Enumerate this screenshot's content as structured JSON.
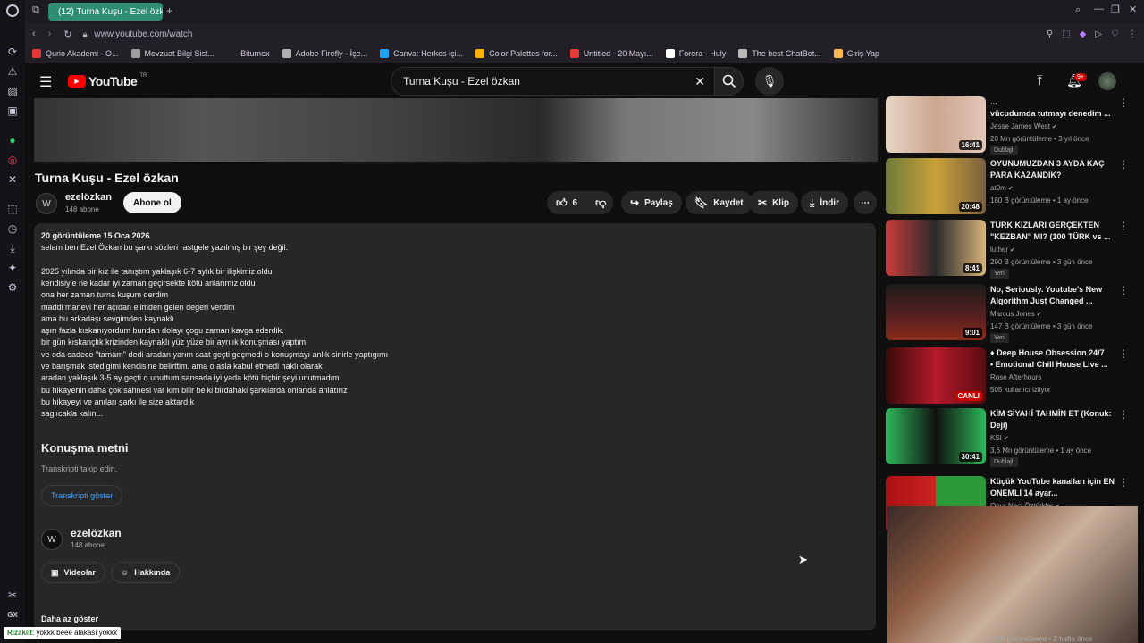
{
  "browser": {
    "tab_title": "(12) Turna Kuşu - Ezel özk",
    "url": "www.youtube.com/watch",
    "bookmarks": [
      {
        "label": "Qurio Akademi - O...",
        "color": "#e53935"
      },
      {
        "label": "Mevzuat Bilgi Sist...",
        "color": "#9e9e9e"
      },
      {
        "label": "Bitumex",
        "color": "#221f27"
      },
      {
        "label": "Adobe Firefly - İçe...",
        "color": "#b0b0b0"
      },
      {
        "label": "Canva: Herkes içi...",
        "color": "#20a4f3"
      },
      {
        "label": "Color Palettes for...",
        "color": "#ffb300"
      },
      {
        "label": "Untitled - 20 Mayı...",
        "color": "#e53935"
      },
      {
        "label": "Forera - Huly",
        "color": "#ffffff"
      },
      {
        "label": "The best ChatBot...",
        "color": "#bbbbbb"
      },
      {
        "label": "Giriş Yap",
        "color": "#ffb74d"
      }
    ]
  },
  "header": {
    "logo": "YouTube",
    "logo_sup": "TR",
    "search_value": "Turna Kuşu - Ezel özkan",
    "notif_count": "9+"
  },
  "video": {
    "title": "Turna Kuşu - Ezel özkan",
    "channel": "ezelözkan",
    "subs": "148 abone",
    "subscribe": "Abone ol",
    "likes": "6",
    "share": "Paylaş",
    "save": "Kaydet",
    "clip": "Klip",
    "download": "İndir"
  },
  "description": {
    "stats": "20 görüntüleme  15 Oca 2026",
    "lines": [
      "selam ben Ezel Özkan bu şarkı sözleri rastgele yazılmış bir şey değil.",
      "",
      "2025 yılında bir kız ile tanıştım yaklaşık 6-7 aylık bir ilişkimiz oldu",
      "kendisiyle ne kadar iyi zaman geçirsekte kötü anlarımız oldu",
      "ona her zaman turna kuşum derdim",
      "maddi manevi her açıdan elimden gelen degeri verdim",
      "ama bu arkadaşı sevgimden kaynaklı",
      "aşırı fazla kıskanıyordum bundan dolayı çogu zaman kavga ederdik.",
      "bir gün kıskançlık krizinden kaynaklı yüz yüze bir ayrılık konuşması yaptım",
      "ve oda sadece \"tamam\" dedi aradan yarım saat geçti geçmedi o konuşmayı anlık sinirle yaptıgımı",
      "ve barışmak istedigimi kendisine belirttim. ama o asla kabul etmedi haklı olarak",
      "aradan yaklaşık 3-5 ay geçti o unuttum sansada iyi yada kötü hiçbir şeyi unutmadım",
      "bu hikayenin daha çok sahnesi var kim bilir belki birdahaki şarkılarda onlarıda anlatırız",
      "bu hikayeyi ve anıları şarkı ile size aktardık",
      "saglıcakla kalın..."
    ],
    "transcript_heading": "Konuşma metni",
    "transcript_sub": "Transkripti takip edin.",
    "transcript_button": "Transkripti göster",
    "channel": "ezelözkan",
    "subs": "148 abone",
    "videos_button": "Videolar",
    "about_button": "Hakkında",
    "show_less": "Daha az göster"
  },
  "recommendations": [
    {
      "title_l1": "...",
      "title_l2": "vücudumda tutmayı denedim ...",
      "channel": "Jesse James West",
      "verified": true,
      "meta": "20 Mn görüntüleme • 3 yıl önce",
      "badge": "Dublajlı",
      "duration": "16:41",
      "thumb_bg": "linear-gradient(90deg,#e8d5c4,#caa68e,#e2c6b8)"
    },
    {
      "title_l1": "OYUNUMUZDAN 3 AYDA KAÇ",
      "title_l2": "PARA KAZANDIK?",
      "channel": "at0m",
      "verified": true,
      "meta": "180 B görüntüleme • 1 ay önce",
      "badge": "",
      "duration": "20:48",
      "thumb_bg": "linear-gradient(90deg,#6e7a3a,#c9a13a,#7b6040)"
    },
    {
      "title_l1": "TÜRK KIZLARI GERÇEKTEN",
      "title_l2": "\"KEZBAN\" MI? (100 TÜRK vs ...",
      "channel": "luther",
      "verified": true,
      "meta": "290 B görüntüleme • 3 gün önce",
      "badge": "Yeni",
      "duration": "8:41",
      "thumb_bg": "linear-gradient(90deg,#cc3b3b,#2a2a2a,#d8b47a)"
    },
    {
      "title_l1": "No, Seriously. Youtube's New",
      "title_l2": "Algorithm Just Changed ...",
      "channel": "Marcus Jones",
      "verified": true,
      "meta": "147 B görüntüleme • 3 gün önce",
      "badge": "Yeni",
      "duration": "9:01",
      "thumb_bg": "linear-gradient(180deg,#1b1b1b 0%,#5b2020 60%,#8a2a1a 100%)"
    },
    {
      "title_l1": "♦ Deep House Obsession 24/7",
      "title_l2": "• Emotional Chill House Live ...",
      "channel": "Rose Afterhours",
      "verified": false,
      "meta": "505 kullanıcı izliyor",
      "badge": "",
      "duration": "CANLI",
      "thumb_bg": "linear-gradient(90deg,#3a0b0b,#b41a2a,#5a0b12)"
    },
    {
      "title_l1": "KİM SİYAHİ TAHMİN ET (Konuk:",
      "title_l2": "Deji)",
      "channel": "KSI",
      "verified": true,
      "meta": "3,6 Mn görüntüleme • 1 ay önce",
      "badge": "Dublajlı",
      "duration": "30:41",
      "thumb_bg": "linear-gradient(90deg,#2fb85a,#111,#2fb85a)"
    },
    {
      "title_l1": "Küçük YouTube kanalları için EN",
      "title_l2": "ÖNEMLİ 14 ayar...",
      "channel": "Onur Naci Öztürkler",
      "verified": true,
      "meta": "",
      "badge": "",
      "duration": "",
      "thumb_bg": "linear-gradient(90deg,#a11,#c22 50%,#2a9a3a 50%,#2a9a3a)"
    }
  ],
  "overlay": {
    "partial_meta": "30 B görüntüleme • 2 hafta önce",
    "chat_user": "Rizakilt",
    "chat_text": ": yokkk beee alakası yokkk"
  },
  "opera_sidebar": {
    "gx_label": "GX"
  }
}
